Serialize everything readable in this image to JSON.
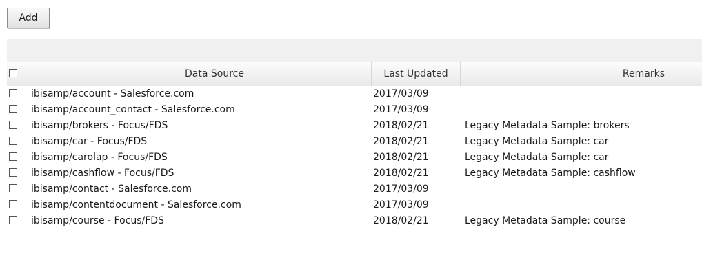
{
  "toolbar": {
    "add_label": "Add"
  },
  "table": {
    "headers": {
      "data_source": "Data Source",
      "last_updated": "Last Updated",
      "remarks": "Remarks"
    },
    "rows": [
      {
        "source": "ibisamp/account - Salesforce.com",
        "updated": "2017/03/09",
        "remarks": ""
      },
      {
        "source": "ibisamp/account_contact - Salesforce.com",
        "updated": "2017/03/09",
        "remarks": ""
      },
      {
        "source": "ibisamp/brokers - Focus/FDS",
        "updated": "2018/02/21",
        "remarks": "Legacy Metadata Sample: brokers"
      },
      {
        "source": "ibisamp/car - Focus/FDS",
        "updated": "2018/02/21",
        "remarks": "Legacy Metadata Sample: car"
      },
      {
        "source": "ibisamp/carolap - Focus/FDS",
        "updated": "2018/02/21",
        "remarks": "Legacy Metadata Sample: car"
      },
      {
        "source": "ibisamp/cashflow - Focus/FDS",
        "updated": "2018/02/21",
        "remarks": "Legacy Metadata Sample: cashflow"
      },
      {
        "source": "ibisamp/contact - Salesforce.com",
        "updated": "2017/03/09",
        "remarks": ""
      },
      {
        "source": "ibisamp/contentdocument - Salesforce.com",
        "updated": "2017/03/09",
        "remarks": ""
      },
      {
        "source": "ibisamp/course - Focus/FDS",
        "updated": "2018/02/21",
        "remarks": "Legacy Metadata Sample: course"
      }
    ]
  }
}
